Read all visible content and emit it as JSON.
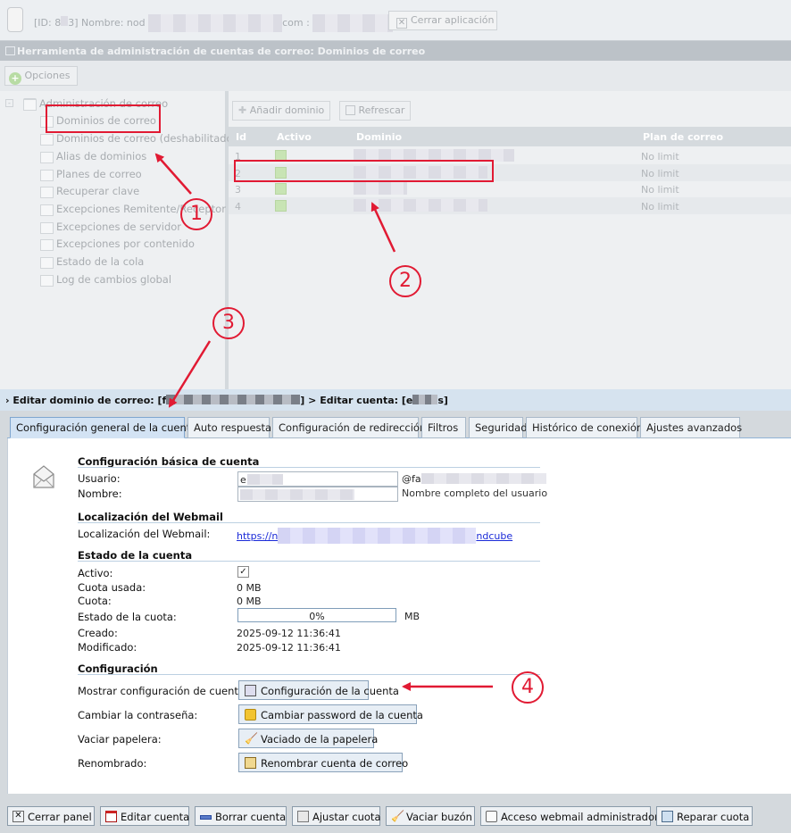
{
  "topbar": {
    "info_prefix": "[ID: 8",
    "info_mid": "3] Nombre: nod",
    "info_suffix": "com :",
    "close_app_label": "Cerrar aplicación"
  },
  "tool_header": "Herramienta de administración de cuentas de correo: Dominios de correo",
  "options_label": "Opciones",
  "tree": {
    "root": "Administración de correo",
    "items": [
      "Dominios de correo",
      "Dominios de correo (deshabilitados)",
      "Alias de dominios",
      "Planes de correo",
      "Recuperar clave",
      "Excepciones Remitente/Receptor",
      "Excepciones de servidor",
      "Excepciones por contenido",
      "Estado de la cola",
      "Log de cambios global"
    ]
  },
  "grid": {
    "add_label": "Añadir dominio",
    "refresh_label": "Refrescar",
    "columns": [
      "Id",
      "Activo",
      "Dominio",
      "Plan de correo"
    ],
    "rows": [
      {
        "id": "1",
        "plan": "No limit"
      },
      {
        "id": "2",
        "plan": "No limit"
      },
      {
        "id": "3",
        "plan": "No limit"
      },
      {
        "id": "4",
        "plan": "No limit"
      }
    ]
  },
  "edit_header": {
    "part1": "Editar dominio de correo: [f",
    "part2": "] > Editar cuenta: [e",
    "part3": "s]"
  },
  "tabs": [
    "Configuración general de la cuenta",
    "Auto respuesta",
    "Configuración de redirección",
    "Filtros",
    "Seguridad",
    "Histórico de conexión",
    "Ajustes avanzados"
  ],
  "basic": {
    "title": "Configuración básica de cuenta",
    "user_label": "Usuario:",
    "user_value": "e",
    "user_domain": "@fa",
    "name_label": "Nombre:",
    "name_hint": "Nombre completo del usuario"
  },
  "webmail": {
    "title": "Localización del Webmail",
    "label": "Localización del Webmail:",
    "link_start": "https://n",
    "link_end": "ndcube"
  },
  "status": {
    "title": "Estado de la cuenta",
    "active_label": "Activo:",
    "active_check": "✓",
    "used_label": "Cuota usada:",
    "used_value": "0 MB",
    "quota_label": "Cuota:",
    "quota_value": "0 MB",
    "quota_state_label": "Estado de la cuota:",
    "quota_percent": "0%",
    "quota_fraction": 0,
    "quota_unit": "MB",
    "created_label": "Creado:",
    "created_value": "2025-09-12 11:36:41",
    "modified_label": "Modificado:",
    "modified_value": "2025-09-12 11:36:41"
  },
  "config": {
    "title": "Configuración",
    "show_label": "Mostrar configuración de cuenta:",
    "show_button": "Configuración de la cuenta",
    "password_label": "Cambiar la contraseña:",
    "password_button": "Cambiar password de la cuenta",
    "trash_label": "Vaciar papelera:",
    "trash_button": "Vaciado de la papelera",
    "rename_label": "Renombrado:",
    "rename_button": "Renombrar cuenta de correo"
  },
  "footer": [
    "Cerrar panel",
    "Editar cuenta",
    "Borrar cuenta",
    "Ajustar cuota",
    "Vaciar buzón",
    "Acceso webmail administrador",
    "Reparar cuota"
  ],
  "annotations": [
    "1",
    "2",
    "3",
    "4"
  ],
  "colors": {
    "annotation_red": "#e11a33",
    "active_tab": "#d3e3f4",
    "link": "#1a2ad8"
  }
}
